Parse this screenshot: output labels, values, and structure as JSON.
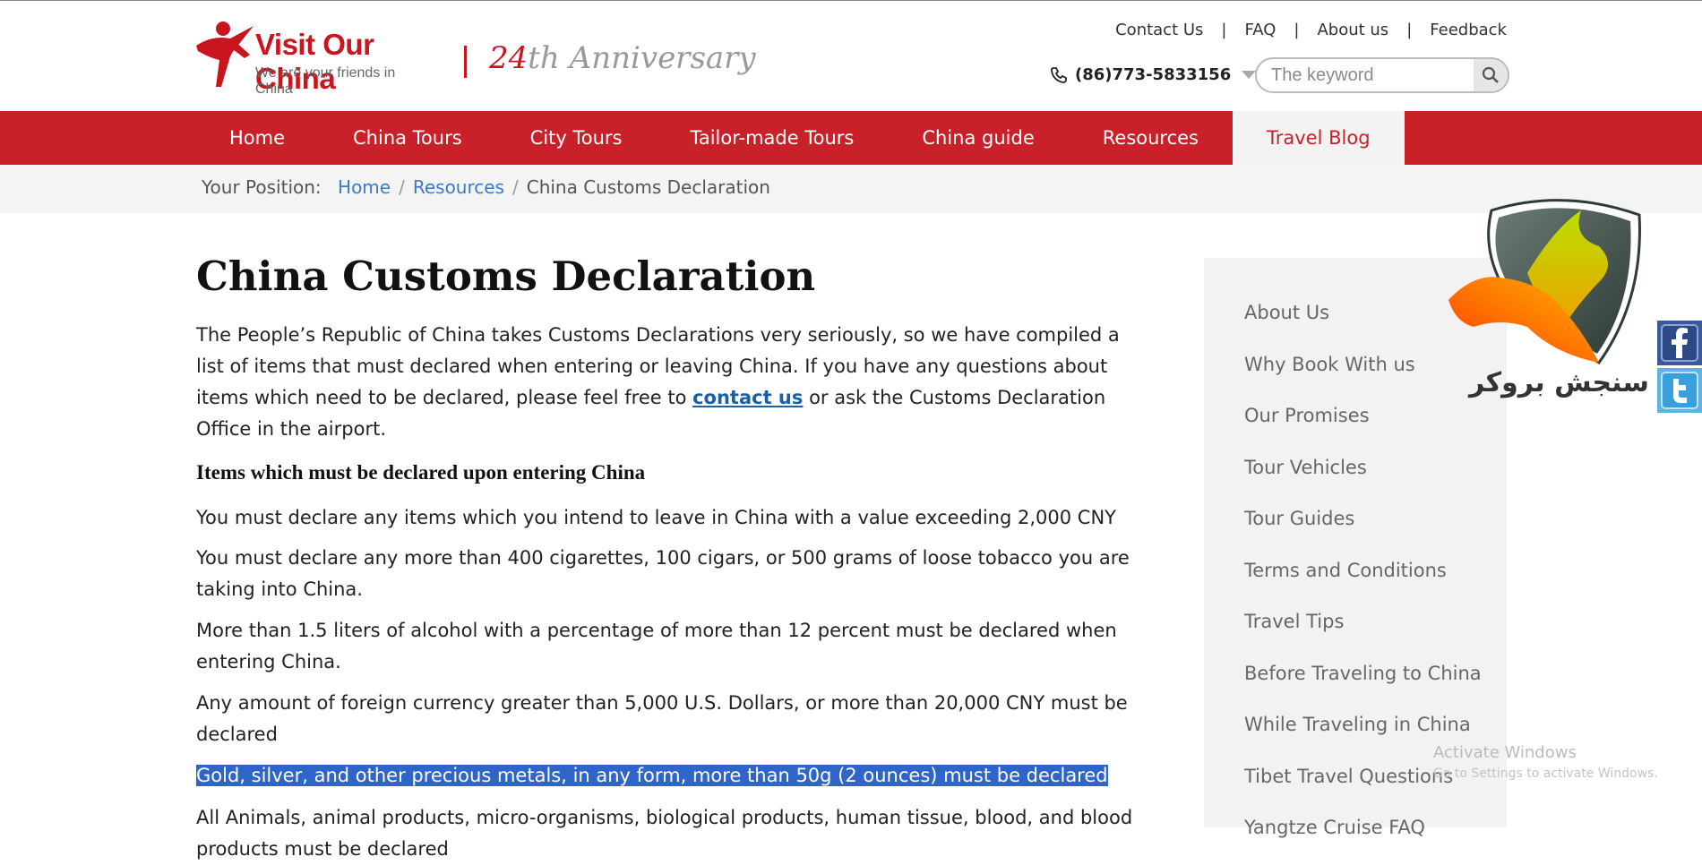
{
  "header": {
    "logo_title": "Visit Our China",
    "logo_subtitle": "We are your friends in China",
    "anniversary_number": "24",
    "anniversary_text": "th Anniversary",
    "top_links": [
      "Contact Us",
      "FAQ",
      "About us",
      "Feedback"
    ],
    "phone": "(86)773-5833156",
    "search_placeholder": "The keyword"
  },
  "nav": {
    "items": [
      "Home",
      "China Tours",
      "City Tours",
      "Tailor-made Tours",
      "China guide",
      "Resources",
      "Travel Blog"
    ],
    "active": "Travel Blog"
  },
  "breadcrumb": {
    "label": "Your Position:",
    "items": [
      "Home",
      "Resources",
      "China Customs Declaration"
    ]
  },
  "article": {
    "title": "China Customs Declaration",
    "intro_before": "The People’s Republic of China takes Customs Declarations very seriously, so we have compiled a list of items that must declared when entering or leaving China. If you have any questions about items which need to be declared, please feel free to ",
    "intro_link": "contact us",
    "intro_after": " or ask the Customs Declaration Office in the airport.",
    "subheading": "Items which must be declared upon entering China",
    "items": [
      "You must declare any items which you intend to leave in China with a value exceeding 2,000 CNY",
      "You must declare any more than 400 cigarettes, 100 cigars, or 500 grams of loose tobacco you are taking into China.",
      "More than 1.5 liters of alcohol with a percentage of more than 12 percent must be declared when entering China.",
      "Any amount of foreign currency greater than 5,000 U.S. Dollars, or more than 20,000 CNY must be declared",
      "Gold, silver, and other precious metals, in any form, more than 50g (2 ounces) must be declared",
      "All Animals, animal products, micro-organisms, biological products, human tissue, blood, and blood products must be declared"
    ]
  },
  "sidebar": {
    "items": [
      "About Us",
      "Why Book With us",
      "Our Promises",
      "Tour Vehicles",
      "Tour Guides",
      "Terms and Conditions",
      "Travel Tips",
      "Before Traveling to China",
      "While Traveling in China",
      "Tibet Travel Questions",
      "Yangtze Cruise FAQ"
    ]
  },
  "overlay": {
    "badge_text": "سنجش بروکر",
    "activate_title": "Activate Windows",
    "activate_sub": "Go to Settings to activate Windows."
  },
  "colors": {
    "brand_red": "#c9202a",
    "link_blue": "#3a7bc8",
    "highlight": "#2f65c9"
  }
}
